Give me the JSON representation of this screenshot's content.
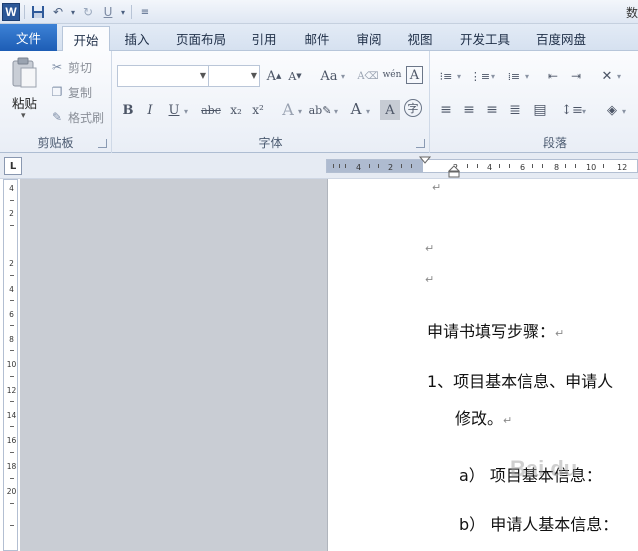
{
  "title_text": "数",
  "tabs": [
    "文件",
    "开始",
    "插入",
    "页面布局",
    "引用",
    "邮件",
    "审阅",
    "视图",
    "开发工具",
    "百度网盘"
  ],
  "clipboard": {
    "paste": "粘贴",
    "cut": "剪切",
    "copy": "复制",
    "format_painter": "格式刷",
    "label": "剪贴板"
  },
  "font_group": {
    "label": "字体",
    "change_case": "Aa",
    "bold": "B",
    "italic": "I",
    "underline": "U",
    "strike": "abc",
    "subscript": "x₂",
    "superscript": "x²",
    "phonetic": "wén"
  },
  "paragraph_group": {
    "label": "段落"
  },
  "ruler": {
    "h_ticks": [
      "4",
      "2",
      "2",
      "4",
      "6",
      "8",
      "10",
      "12"
    ],
    "v_ticks": [
      "4",
      "2",
      "2",
      "4",
      "6",
      "8",
      "10",
      "12",
      "14",
      "16",
      "18",
      "20"
    ]
  },
  "document": {
    "lines": [
      "申请书填写步骤：",
      "1、项目基本信息、申请人",
      "修改。",
      "a）  项目基本信息：",
      "b）  申请人基本信息："
    ],
    "para_mark": "↵"
  }
}
